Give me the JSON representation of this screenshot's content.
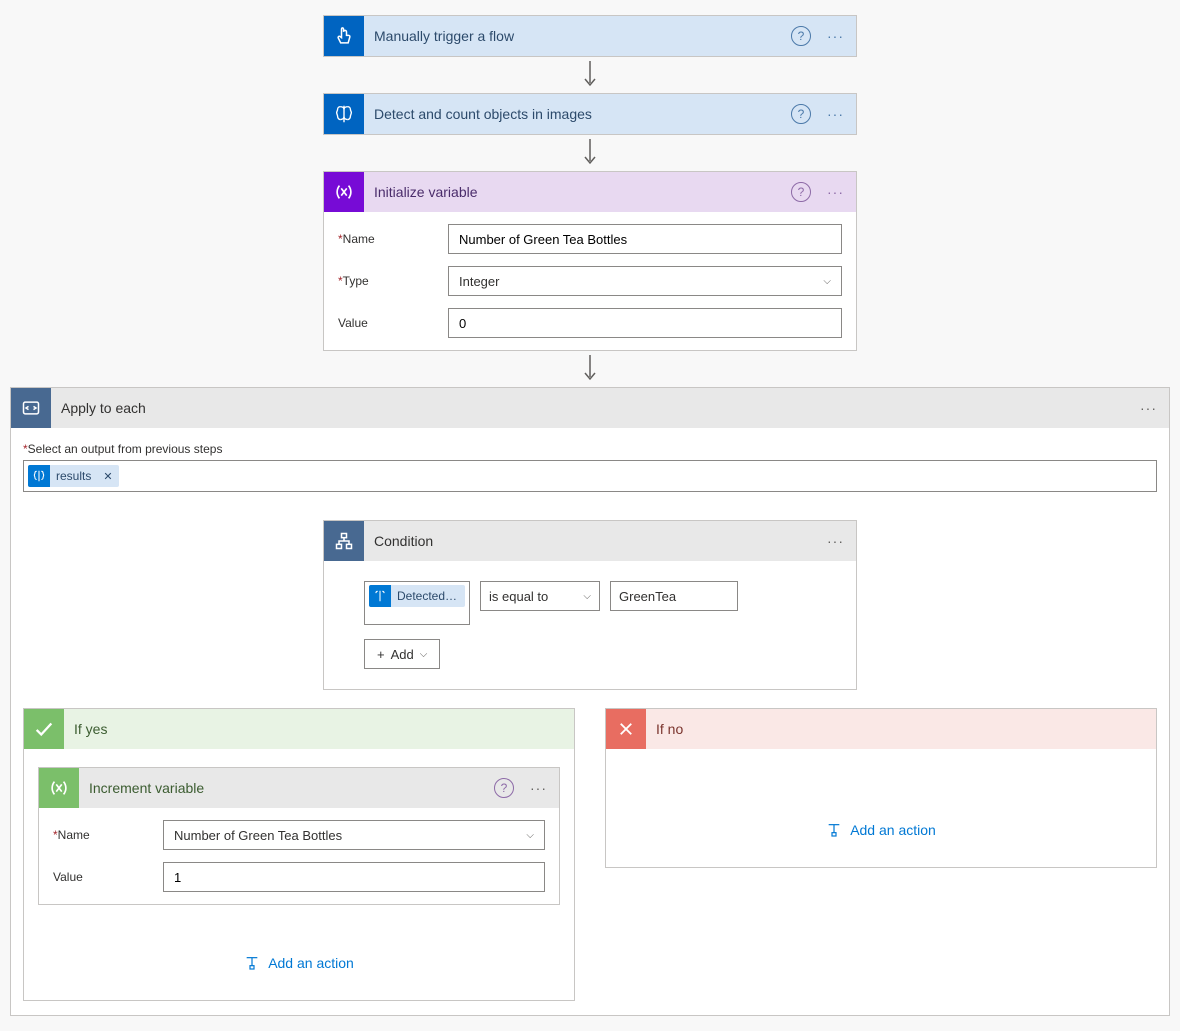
{
  "steps": {
    "trigger": {
      "title": "Manually trigger a flow"
    },
    "detect": {
      "title": "Detect and count objects in images"
    },
    "init_var": {
      "title": "Initialize variable",
      "name_label": "Name",
      "name_value": "Number of Green Tea Bottles",
      "type_label": "Type",
      "type_value": "Integer",
      "value_label": "Value",
      "value_value": "0"
    }
  },
  "apply_each": {
    "title": "Apply to each",
    "select_label": "Select an output from previous steps",
    "token": "results"
  },
  "condition": {
    "title": "Condition",
    "left_token": "Detected…",
    "operator": "is equal to",
    "right_value": "GreenTea",
    "add_label": "Add"
  },
  "branch_yes": {
    "title": "If yes",
    "increment": {
      "title": "Increment variable",
      "name_label": "Name",
      "name_value": "Number of Green Tea Bottles",
      "value_label": "Value",
      "value_value": "1"
    },
    "add_action": "Add an action"
  },
  "branch_no": {
    "title": "If no",
    "add_action": "Add an action"
  }
}
